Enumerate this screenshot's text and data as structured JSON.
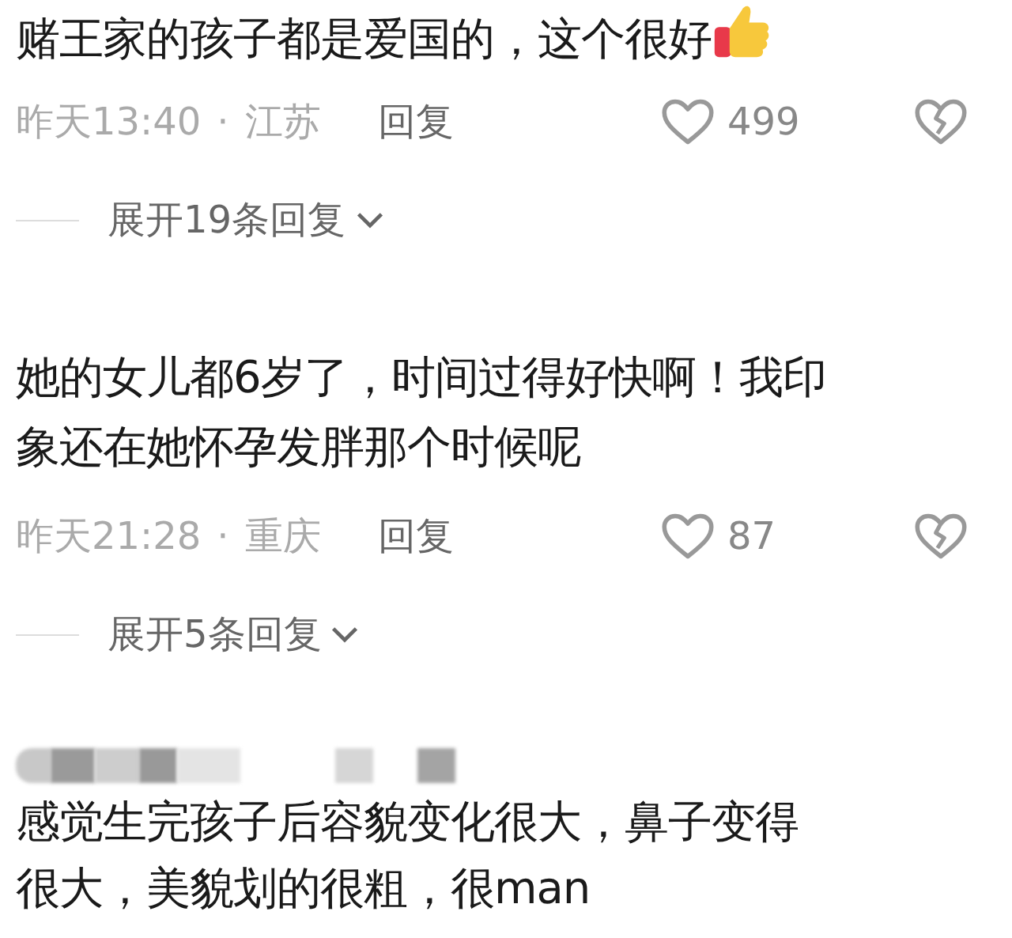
{
  "comments": [
    {
      "lines": [
        "赌王家的孩子都是爱国的，这个很好"
      ],
      "thumbs_up": true,
      "time": "昨天13:40",
      "separator": "·",
      "location": "江苏",
      "reply": "回复",
      "likes": "499",
      "expand": "展开19条回复"
    },
    {
      "lines": [
        "她的女儿都6岁了，时间过得好快啊！我印",
        "象还在她怀孕发胖那个时候呢"
      ],
      "time": "昨天21:28",
      "separator": "·",
      "location": "重庆",
      "reply": "回复",
      "likes": "87",
      "expand": "展开5条回复"
    },
    {
      "author_hidden": true,
      "lines": [
        "感觉生完孩子后容貌变化很大，鼻子变得",
        "很大，美貌划的很粗，很man"
      ]
    }
  ]
}
